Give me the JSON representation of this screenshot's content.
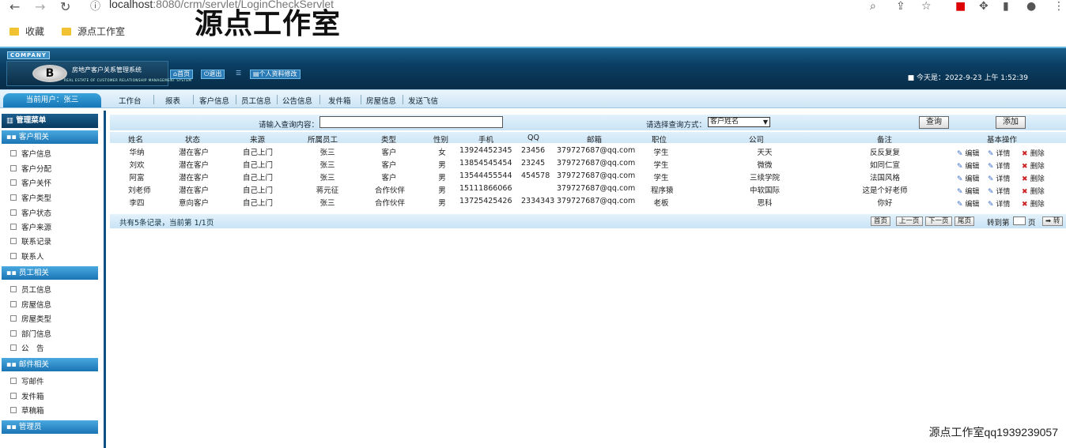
{
  "browser": {
    "url_host": "localhost",
    "url_rest": ":8080/crm/servlet/LoginCheckServlet",
    "bookmarks": [
      "收藏",
      "源点工作室"
    ]
  },
  "watermark_top": "源点工作室",
  "watermark_bottom": "源点工作室qq1939239057",
  "header": {
    "company": "COMPANY",
    "system_name": "房地产客户关系管理系统",
    "system_name_en": "REAL ESTATE OF CUSTOMER RELATIONSHIP MANAGEMENT SYSTEM",
    "logo_letter": "B",
    "nav": [
      "首页",
      "退出",
      "个人资料修改"
    ],
    "today": "■ 今天是：2022-9-23 上午 1:52:39"
  },
  "menubar": {
    "current_user": "当前用户：张三",
    "items": [
      "工作台",
      "报表",
      "客户信息",
      "员工信息",
      "公告信息",
      "发件箱",
      "房屋信息",
      "发送飞信"
    ]
  },
  "sidebar": {
    "title": "管理菜单",
    "groups": [
      {
        "label": "客户相关",
        "items": [
          "客户信息",
          "客户分配",
          "客户关怀",
          "客户类型",
          "客户状态",
          "客户来源",
          "联系记录",
          "联系人"
        ]
      },
      {
        "label": "员工相关",
        "items": [
          "员工信息",
          "房屋信息",
          "房屋类型",
          "部门信息",
          "公　告"
        ]
      },
      {
        "label": "邮件相关",
        "items": [
          "写邮件",
          "发件箱",
          "草稿箱"
        ]
      },
      {
        "label": "管理员",
        "items": []
      }
    ]
  },
  "query": {
    "content_label": "请输入查询内容：",
    "content_value": "",
    "method_label": "请选择查询方式：",
    "method_value": "客户姓名",
    "search_button": "查询",
    "add_button": "添加"
  },
  "table": {
    "columns": [
      "姓名",
      "状态",
      "来源",
      "所属员工",
      "类型",
      "性别",
      "手机",
      "QQ",
      "邮箱",
      "职位",
      "公司",
      "备注",
      "基本操作"
    ],
    "rows": [
      [
        "华纳",
        "潜在客户",
        "自己上门",
        "张三",
        "客户",
        "女",
        "13924452345",
        "23456",
        "379727687@qq.com",
        "学生",
        "天天",
        "反反复复"
      ],
      [
        "刘欢",
        "潜在客户",
        "自己上门",
        "张三",
        "客户",
        "男",
        "13854545454",
        "23245",
        "379727687@qq.com",
        "学生",
        "微微",
        "如同仁宣"
      ],
      [
        "阿富",
        "潜在客户",
        "自己上门",
        "张三",
        "客户",
        "男",
        "13544455544",
        "454578",
        "379727687@qq.com",
        "学生",
        "三续学院",
        "法国风格"
      ],
      [
        "刘老师",
        "潜在客户",
        "自己上门",
        "蒋元征",
        "合作伙伴",
        "男",
        "15111866066",
        "",
        "379727687@qq.com",
        "程序猿",
        "中软国际",
        "这是个好老师"
      ],
      [
        "李四",
        "意向客户",
        "自己上门",
        "张三",
        "合作伙伴",
        "男",
        "13725425426",
        "2334343",
        "379727687@qq.com",
        "老板",
        "思科",
        "你好"
      ]
    ],
    "ops": [
      "编辑",
      "详情",
      "删除"
    ]
  },
  "pager": {
    "summary": "共有5条记录，当前第 1/1页",
    "buttons": [
      "首页",
      "上一页",
      "下一页",
      "尾页"
    ],
    "goto_label": "转到第",
    "goto_unit": "页",
    "goto_button": "➡ 转"
  }
}
